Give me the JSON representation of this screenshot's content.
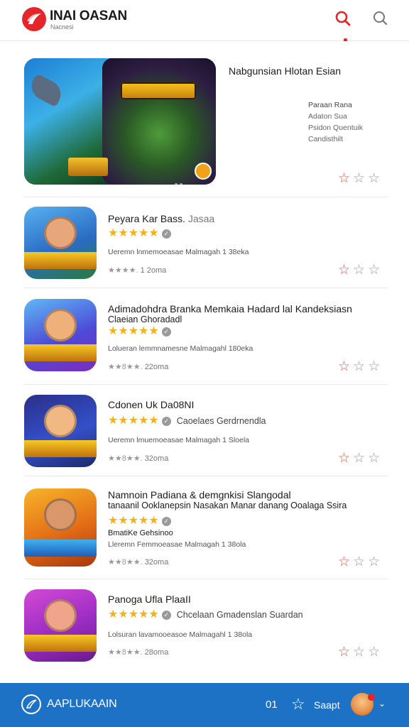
{
  "header": {
    "brand_title": "INAI OASAN",
    "brand_subtitle": "Nacnesi",
    "icons": [
      "brand-logo-icon",
      "search-icon-active",
      "search-icon"
    ],
    "accent_color": "#e3262a"
  },
  "featured": {
    "title": "Nabgunsian Hlotan Esian",
    "meta": [
      "Paraan Rana",
      "Adaton Sua",
      "Psidon Quentuik",
      "Candisthilt"
    ],
    "rating_stars_filled": 1,
    "rating_stars_total": 3
  },
  "apps": [
    {
      "title": "Peyara Kar Bass.",
      "title_muted": "Jasaa",
      "subtitle": "",
      "developer": "",
      "description": "Ueremn lnmemoeasae Malmagah 1 38eka",
      "size": "1 2oma",
      "size_prefix": "★★★★.",
      "stars": 5,
      "rating_stars_filled": 1,
      "rating_stars_total": 3,
      "icon_bg": "#3a7bd3"
    },
    {
      "title": "Adimadohdra Branka Memkaia Hadard lal Kandeksiasn",
      "title_line2": "Claeian Ghoradadl",
      "subtitle": "",
      "developer": "",
      "description": "Lolueran lemmnamesne Malmagahl 180eka",
      "size": "22oma",
      "size_prefix": "★★8★★.",
      "stars": 5,
      "rating_stars_filled": 1,
      "rating_stars_total": 3,
      "icon_bg": "#4c3ad3"
    },
    {
      "title": "Cdonen Uk Da08NI",
      "title_line2": "",
      "subtitle": "",
      "developer": "Caoelaes Gerdrnendla",
      "description": "Ueremn lmuemoeasae Malmagah 1 Sloela",
      "size": "32oma",
      "size_prefix": "★★8★★.",
      "stars": 5,
      "rating_stars_filled": 1,
      "rating_stars_total": 3,
      "icon_bg": "#2944a8"
    },
    {
      "title": "Namnoin Padiana & demgnkisi Slangodal",
      "title_line2": "tanaanil Ooklanepsin Nasakan Manar danang Ooalaga Ssira",
      "subtitle": "BmatiKe Gehsinoo",
      "developer": "",
      "description": "Lleremn Femmoeasae Malmagah 1 38ola",
      "size": "32oma",
      "size_prefix": "★★8★★.",
      "stars": 5,
      "rating_stars_filled": 1,
      "rating_stars_total": 3,
      "icon_bg": "#e37b1a"
    },
    {
      "title": "Panoga Ufla PlaaII",
      "title_line2": "",
      "subtitle": "",
      "developer": "Chcelaan Gmadenslan Suardan",
      "description": "Lolsuran lavamooeasoe Malmagahl 1 38ola",
      "size": "28oma",
      "size_prefix": "★★8★★.",
      "stars": 5,
      "rating_stars_filled": 1,
      "rating_stars_total": 3,
      "icon_bg": "#b135c2"
    }
  ],
  "bottom_bar": {
    "label": "AAPLUKAAIN",
    "count": "01",
    "search_label": "Saapt",
    "background": "#1d72c5"
  }
}
